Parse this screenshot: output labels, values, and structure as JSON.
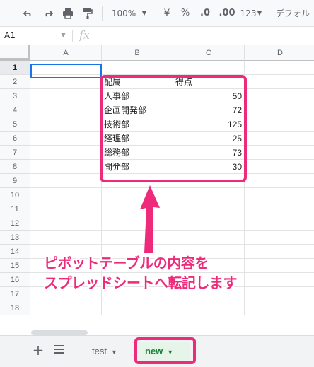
{
  "toolbar": {
    "undo_icon": "undo-icon",
    "redo_icon": "redo-icon",
    "print_icon": "print-icon",
    "paint_format_icon": "paint-format-icon",
    "zoom": "100%",
    "currency": "¥",
    "percent": "%",
    "decrease_decimal": ".0",
    "increase_decimal": ".00",
    "more_formats": "123",
    "font": "デフォル"
  },
  "formula_bar": {
    "cell_ref": "A1",
    "fx": "fx"
  },
  "grid": {
    "columns": [
      "A",
      "B",
      "C",
      "D"
    ],
    "rows": [
      "1",
      "2",
      "3",
      "4",
      "5",
      "6",
      "7",
      "8",
      "9",
      "10",
      "11",
      "12",
      "13",
      "14",
      "15",
      "16",
      "17",
      "18"
    ],
    "table": {
      "headers": [
        "配属",
        "得点"
      ],
      "rows": [
        [
          "人事部",
          "50"
        ],
        [
          "企画開発部",
          "72"
        ],
        [
          "技術部",
          "125"
        ],
        [
          "経理部",
          "25"
        ],
        [
          "総務部",
          "73"
        ],
        [
          "開発部",
          "30"
        ]
      ]
    }
  },
  "annotation": {
    "line1": "ピボットテーブルの内容を",
    "line2": "スプレッドシートへ転記します",
    "color": "#ee2a7b"
  },
  "sheet_tabs": {
    "add_icon": "plus-icon",
    "list_icon": "sheet-list-icon",
    "tabs": [
      "test",
      "new"
    ],
    "active": "new"
  }
}
